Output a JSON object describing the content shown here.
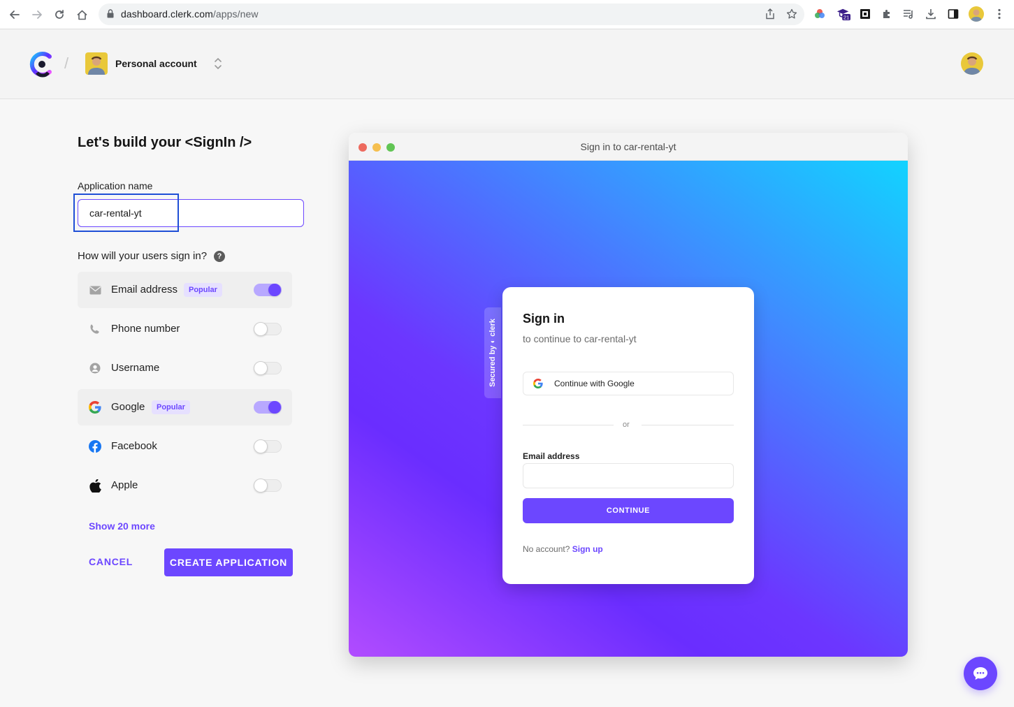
{
  "browser": {
    "url_host": "dashboard.clerk.com",
    "url_path": "/apps/new",
    "extension_badge": "21"
  },
  "header": {
    "account_name": "Personal account",
    "separator": "/"
  },
  "form": {
    "title": "Let's build your <SignIn />",
    "app_name_label": "Application name",
    "app_name_value": "car-rental-yt",
    "question": "How will your users sign in?",
    "help": "?",
    "options": [
      {
        "label": "Email address",
        "badge": "Popular",
        "enabled": true
      },
      {
        "label": "Phone number",
        "badge": "",
        "enabled": false
      },
      {
        "label": "Username",
        "badge": "",
        "enabled": false
      },
      {
        "label": "Google",
        "badge": "Popular",
        "enabled": true
      },
      {
        "label": "Facebook",
        "badge": "",
        "enabled": false
      },
      {
        "label": "Apple",
        "badge": "",
        "enabled": false
      }
    ],
    "show_more": "Show 20 more",
    "cancel": "CANCEL",
    "create": "CREATE APPLICATION"
  },
  "preview": {
    "window_title": "Sign in to car-rental-yt",
    "secured_by": "Secured by",
    "clerk_brand": "clerk",
    "card_title": "Sign in",
    "card_subtitle": "to continue to car-rental-yt",
    "google_button": "Continue with Google",
    "or": "or",
    "email_label": "Email address",
    "continue": "CONTINUE",
    "no_account": "No account?",
    "sign_up": "Sign up"
  },
  "colors": {
    "accent": "#6c47ff",
    "focus_outline": "#1f4fd6"
  }
}
